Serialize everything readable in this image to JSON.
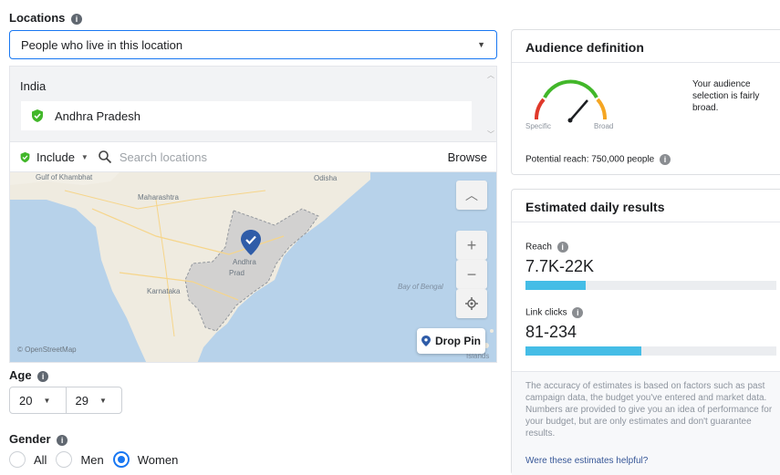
{
  "locations": {
    "heading": "Locations",
    "type_select": "People who live in this location",
    "country": "India",
    "selected": "Andhra Pradesh",
    "include_label": "Include",
    "search_placeholder": "Search locations",
    "browse": "Browse",
    "map_labels": {
      "odisha": "Odisha",
      "maharashtra": "Maharashtra",
      "andhra_1": "Andhra",
      "andhra_2": "Prad",
      "karnataka": "Karnataka",
      "bay_of_bengal": "Bay of Bengal",
      "top_left": "Gulf of Khambhat",
      "islands": "Islands",
      "attribution": "© OpenStreetMap"
    },
    "drop_pin": "Drop Pin"
  },
  "age": {
    "heading": "Age",
    "min": "20",
    "max": "29"
  },
  "gender": {
    "heading": "Gender",
    "options": [
      "All",
      "Men",
      "Women"
    ],
    "selected": "Women"
  },
  "audience_definition": {
    "title": "Audience definition",
    "gauge_specific": "Specific",
    "gauge_broad": "Broad",
    "description": "Your audience selection is fairly broad.",
    "potential_reach": "Potential reach: 750,000 people"
  },
  "estimated_daily_results": {
    "title": "Estimated daily results",
    "reach_label": "Reach",
    "reach_value": "7.7K-22K",
    "reach_fill": 0.24,
    "link_clicks_label": "Link clicks",
    "link_clicks_value": "81-234",
    "link_clicks_fill": 0.46,
    "disclaimer": "The accuracy of estimates is based on factors such as past campaign data, the budget you've entered and market data. Numbers are provided to give you an idea of performance for your budget, but are only estimates and don't guarantee results.",
    "helpful_link": "Were these estimates helpful?"
  },
  "colors": {
    "accent": "#1877f2",
    "bar_fill": "#45bde6",
    "include_green": "#42b72a"
  }
}
